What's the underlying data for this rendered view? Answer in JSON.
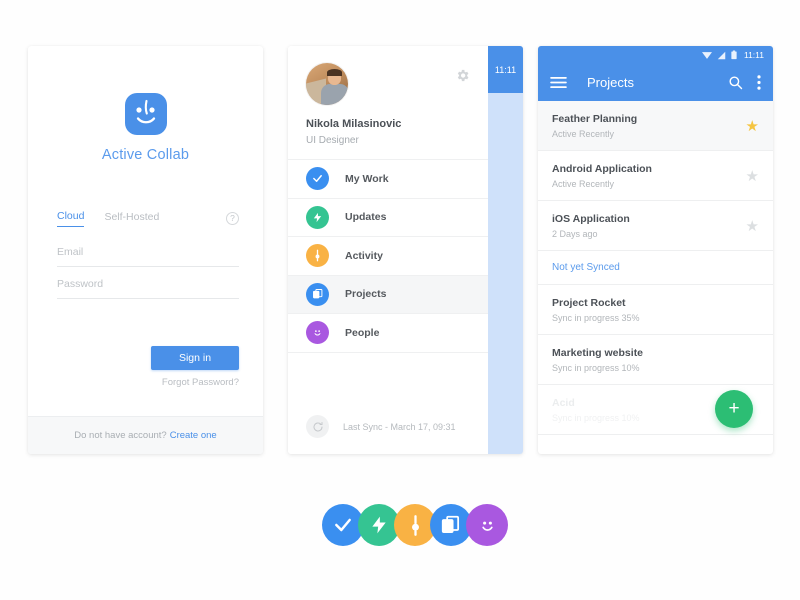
{
  "login": {
    "brand": "Active Collab",
    "logo_icon": "active-collab-face-logo",
    "logo_color": "#4a90e8",
    "tabs": [
      {
        "label": "Cloud",
        "active": true
      },
      {
        "label": "Self-Hosted",
        "active": false
      }
    ],
    "help_icon": "question-mark-icon",
    "help_glyph": "?",
    "email": {
      "placeholder": "Email",
      "value": ""
    },
    "password": {
      "placeholder": "Password",
      "value": ""
    },
    "signin_label": "Sign in",
    "forgot_label": "Forgot Password?",
    "footer_text": "Do not have account?",
    "footer_link": "Create one"
  },
  "menu": {
    "status_time": "11:11",
    "gear_icon": "gear-icon",
    "profile": {
      "name": "Nikola Milasinovic",
      "role": "UI Designer",
      "avatar_icon": "user-photo-avatar"
    },
    "items": [
      {
        "label": "My Work",
        "icon": "check-icon",
        "color": "#3a8ff0",
        "selected": false
      },
      {
        "label": "Updates",
        "icon": "bolt-icon",
        "color": "#35c492",
        "selected": false
      },
      {
        "label": "Activity",
        "icon": "pin-icon",
        "color": "#f9b244",
        "selected": false
      },
      {
        "label": "Projects",
        "icon": "layers-icon",
        "color": "#3a8ff0",
        "selected": true
      },
      {
        "label": "People",
        "icon": "smiley-icon",
        "color": "#a958e0",
        "selected": false
      }
    ],
    "sync_icon": "refresh-icon",
    "sync_text": "Last Sync -  March 17, 09:31"
  },
  "projects": {
    "status": {
      "time": "11:11",
      "icons": [
        "wifi-icon",
        "signal-icon",
        "battery-icon"
      ]
    },
    "toolbar": {
      "menu_icon": "hamburger-menu-icon",
      "title": "Projects",
      "search_icon": "search-icon",
      "overflow_icon": "more-vertical-icon"
    },
    "rows": [
      {
        "title": "Feather Planning",
        "sub": "Active Recently",
        "starred": true,
        "highlight": true,
        "faded": false
      },
      {
        "title": "Android Application",
        "sub": "Active Recently",
        "starred": false,
        "highlight": false,
        "faded": false
      },
      {
        "title": "iOS Application",
        "sub": "2 Days ago",
        "starred": false,
        "highlight": false,
        "faded": false
      }
    ],
    "section_label": "Not yet Synced",
    "pending": [
      {
        "title": "Project Rocket",
        "sub": "Sync in progress 35%",
        "faded": false
      },
      {
        "title": "Marketing website",
        "sub": "Sync in progress 10%",
        "faded": false
      },
      {
        "title": "Acid",
        "sub": "Sync in progress 10%",
        "faded": true
      }
    ],
    "fab": {
      "icon": "plus-icon",
      "glyph": "+",
      "color": "#2cbe74"
    }
  },
  "icon_row": [
    {
      "name": "check-icon",
      "color": "#3a8ff0"
    },
    {
      "name": "bolt-icon",
      "color": "#35c492"
    },
    {
      "name": "pin-icon",
      "color": "#f9b244"
    },
    {
      "name": "layers-icon",
      "color": "#3a8ff0"
    },
    {
      "name": "smiley-icon",
      "color": "#a958e0"
    }
  ]
}
